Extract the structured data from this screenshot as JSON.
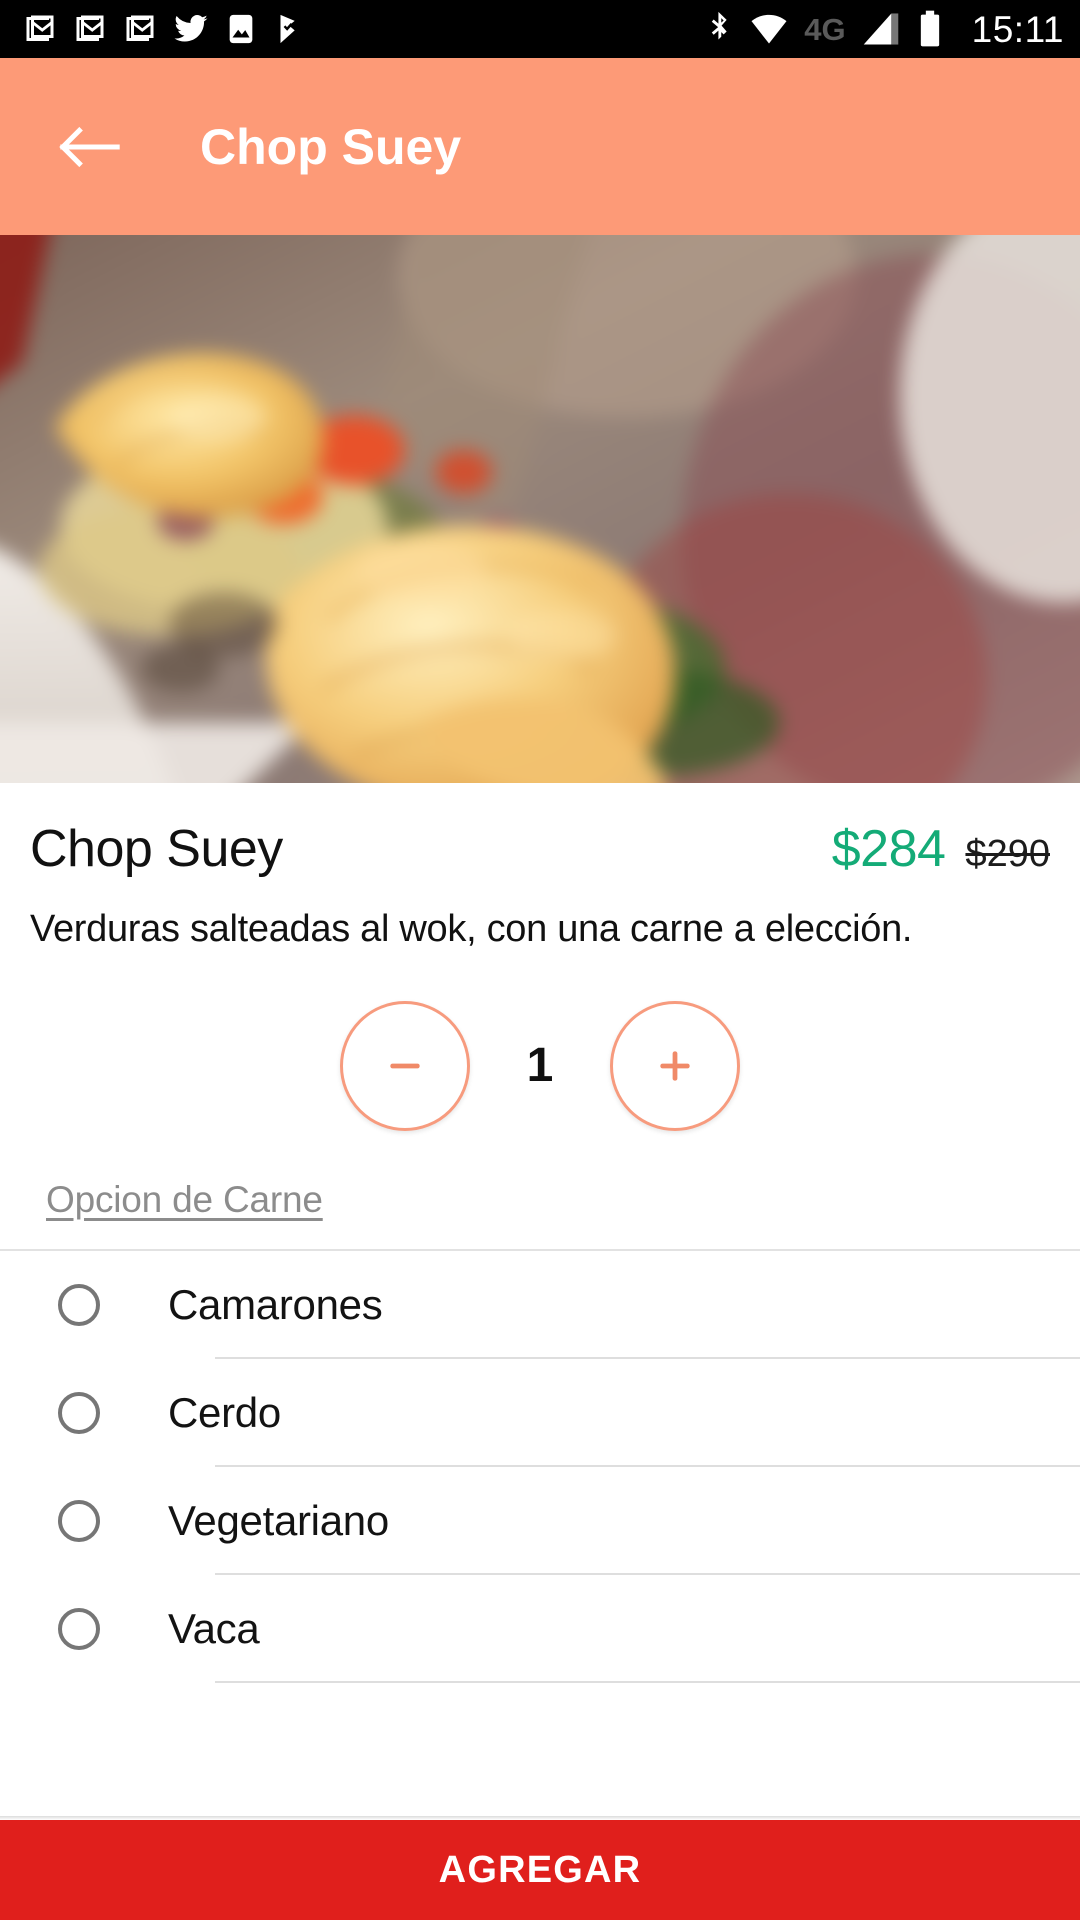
{
  "status_bar": {
    "time": "15:11",
    "network_label": "4G",
    "left_icons": [
      "gmail-icon",
      "gmail-icon",
      "gmail-icon",
      "twitter-icon",
      "photo-icon",
      "task-check-icon"
    ],
    "right_icons": [
      "bluetooth-icon",
      "wifi-icon",
      "network-4g-label",
      "cell-signal-icon",
      "battery-icon"
    ]
  },
  "app_bar": {
    "title": "Chop Suey",
    "back_icon": "arrow-left-icon",
    "background_color": "#fd9a77"
  },
  "hero": {
    "alt": "chop-suey-dish-photo"
  },
  "product": {
    "name": "Chop Suey",
    "price_current": "$284",
    "price_original": "$290",
    "price_current_color": "#14ab77",
    "description": "Verduras salteadas al wok, con una carne a elección."
  },
  "quantity": {
    "decrease_icon": "minus-icon",
    "increase_icon": "plus-icon",
    "value": "1",
    "accent_color": "#f79b7e"
  },
  "option_group": {
    "title": "Opcion de Carne",
    "options": [
      {
        "label": "Camarones",
        "selected": false
      },
      {
        "label": "Cerdo",
        "selected": false
      },
      {
        "label": "Vegetariano",
        "selected": false
      },
      {
        "label": "Vaca",
        "selected": false
      }
    ]
  },
  "cta": {
    "label": "AGREGAR",
    "background_color": "#e01f1c"
  }
}
